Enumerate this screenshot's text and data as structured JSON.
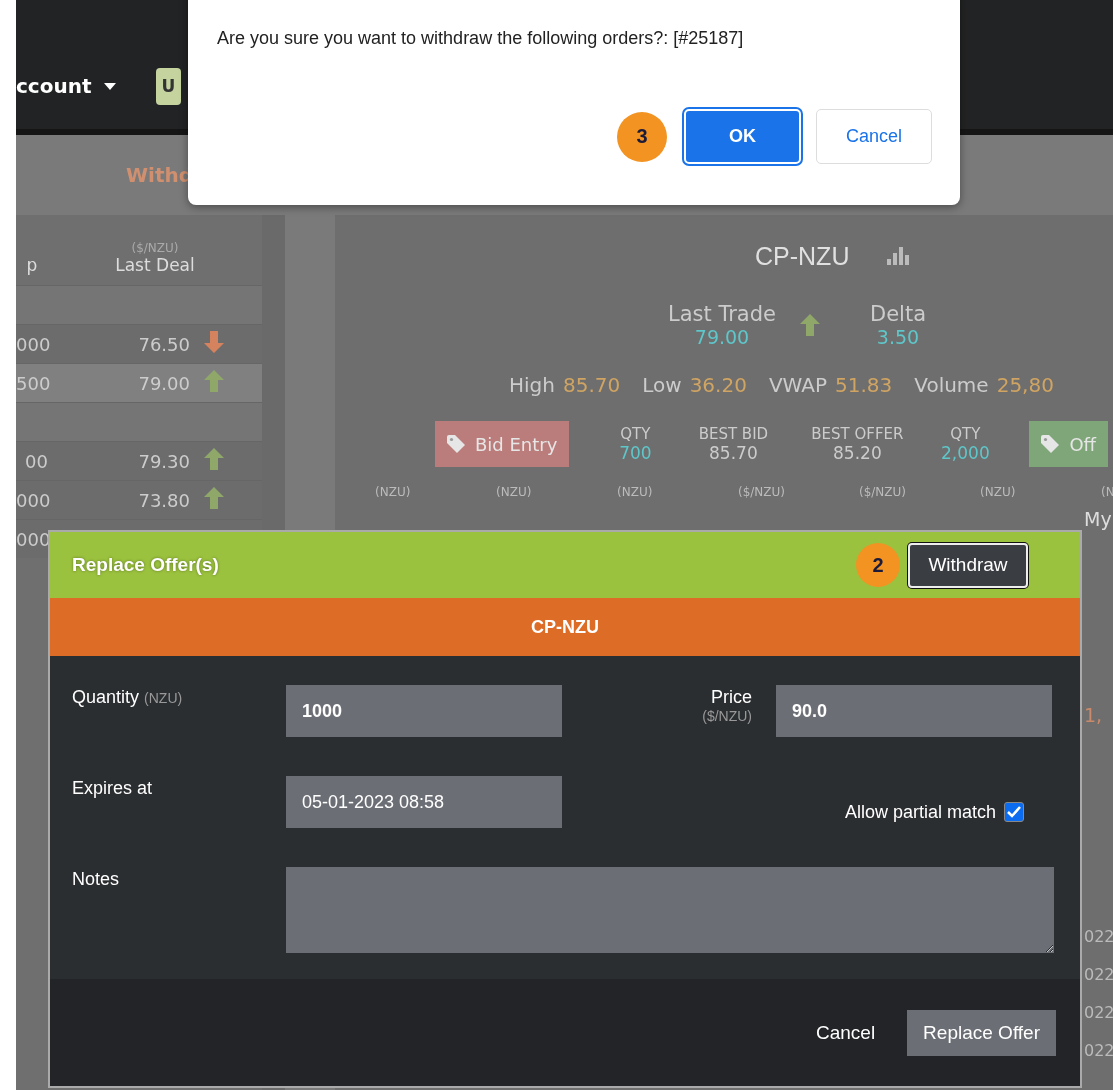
{
  "header": {
    "account_menu": "ccount",
    "badge": "U"
  },
  "tab_bar": {
    "tab": "Withd"
  },
  "market_table": {
    "columns": [
      {
        "label": "p"
      },
      {
        "unit": "($/NZU)",
        "label": "Last Deal"
      }
    ],
    "rows": [
      {
        "kind": "group"
      },
      {
        "kind": "deal",
        "column_1": "000",
        "last_deal": "76.50",
        "rising": false,
        "selected": false
      },
      {
        "kind": "deal",
        "column_1": "500",
        "last_deal": "79.00",
        "rising": true,
        "selected": true
      },
      {
        "kind": "group"
      },
      {
        "kind": "deal",
        "column_1": "00",
        "last_deal": "79.30",
        "rising": true,
        "selected": false
      },
      {
        "kind": "deal",
        "column_1": "000",
        "last_deal": "73.80",
        "rising": true,
        "selected": false
      },
      {
        "kind": "deal",
        "column_1": "000",
        "selected": false
      }
    ]
  },
  "instrument": {
    "name": "CP-NZU",
    "last_trade": {
      "label": "Last Trade",
      "value": "79.00"
    },
    "rising": true,
    "delta": {
      "label": "Delta",
      "value": "3.50"
    },
    "stats": [
      {
        "label": "High",
        "value": "85.70"
      },
      {
        "label": "Low",
        "value": "36.20"
      },
      {
        "label": "VWAP",
        "value": "51.83"
      },
      {
        "label": "Volume",
        "value": "25,80"
      }
    ],
    "bid_button": "Bid Entry",
    "best": [
      {
        "label": "QTY",
        "value": "700",
        "kind": "qty"
      },
      {
        "label": "BEST BID",
        "value": "85.70",
        "kind": "price"
      },
      {
        "label": "BEST OFFER",
        "value": "85.20",
        "kind": "price"
      },
      {
        "label": "QTY",
        "value": "2,000",
        "kind": "qty"
      }
    ],
    "offer_button": "Off",
    "units": [
      "(NZU)",
      "(NZU)",
      "(NZU)",
      "($/NZU)",
      "($/NZU)",
      "(NZU)",
      "(N"
    ]
  },
  "orders_edge": {
    "heading": "My",
    "values": [
      {
        "text": "1,",
        "kind": "amount"
      },
      {
        "text": "022",
        "kind": "date"
      },
      {
        "text": "022",
        "kind": "date"
      },
      {
        "text": "022",
        "kind": "date"
      },
      {
        "text": "022",
        "kind": "date"
      }
    ]
  },
  "replace_modal": {
    "title": "Replace Offer(s)",
    "step_badge": "2",
    "withdraw_button": "Withdraw",
    "instrument": "CP-NZU",
    "quantity": {
      "label": "Quantity",
      "unit": "(NZU)",
      "value": "1000"
    },
    "price": {
      "label": "Price",
      "unit": "($/NZU)",
      "value": "90.0"
    },
    "expires": {
      "label": "Expires at",
      "value": "05-01-2023 08:58"
    },
    "partial_match": {
      "label": "Allow partial match",
      "checked": true
    },
    "notes": {
      "label": "Notes"
    },
    "cancel": "Cancel",
    "submit": "Replace Offer"
  },
  "confirm_dialog": {
    "message": "Are you sure you want to withdraw the following orders?: [#25187]",
    "step_badge": "3",
    "ok": "OK",
    "cancel": "Cancel"
  }
}
